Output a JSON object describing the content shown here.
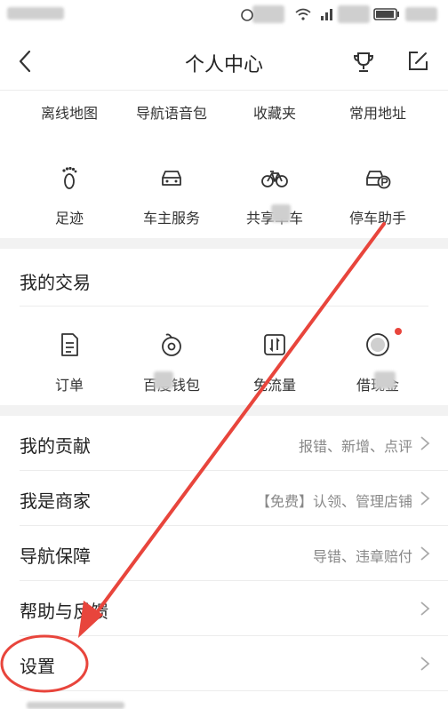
{
  "header": {
    "title": "个人中心"
  },
  "tools_row": [
    {
      "label": "离线地图"
    },
    {
      "label": "导航语音包"
    },
    {
      "label": "收藏夹"
    },
    {
      "label": "常用地址"
    }
  ],
  "services": [
    {
      "label": "足迹",
      "icon": "footprint-icon"
    },
    {
      "label": "车主服务",
      "icon": "car-icon"
    },
    {
      "label": "共享单车",
      "icon": "bicycle-icon"
    },
    {
      "label": "停车助手",
      "icon": "parking-car-icon"
    }
  ],
  "trade": {
    "title": "我的交易",
    "items": [
      {
        "label": "订单",
        "icon": "order-icon"
      },
      {
        "label": "百度钱包",
        "icon": "wallet-icon"
      },
      {
        "label": "免流量",
        "icon": "data-free-icon"
      },
      {
        "label": "借现金",
        "icon": "cash-icon"
      }
    ]
  },
  "list": [
    {
      "main": "我的贡献",
      "sub": "报错、新增、点评"
    },
    {
      "main": "我是商家",
      "sub": "【免费】认领、管理店铺"
    },
    {
      "main": "导航保障",
      "sub": "导错、违章赔付"
    },
    {
      "main": "帮助与反馈",
      "sub": ""
    },
    {
      "main": "设置",
      "sub": ""
    }
  ],
  "colors": {
    "annotation": "#e8453c",
    "divider": "#ececec",
    "gap": "#f2f2f2"
  }
}
